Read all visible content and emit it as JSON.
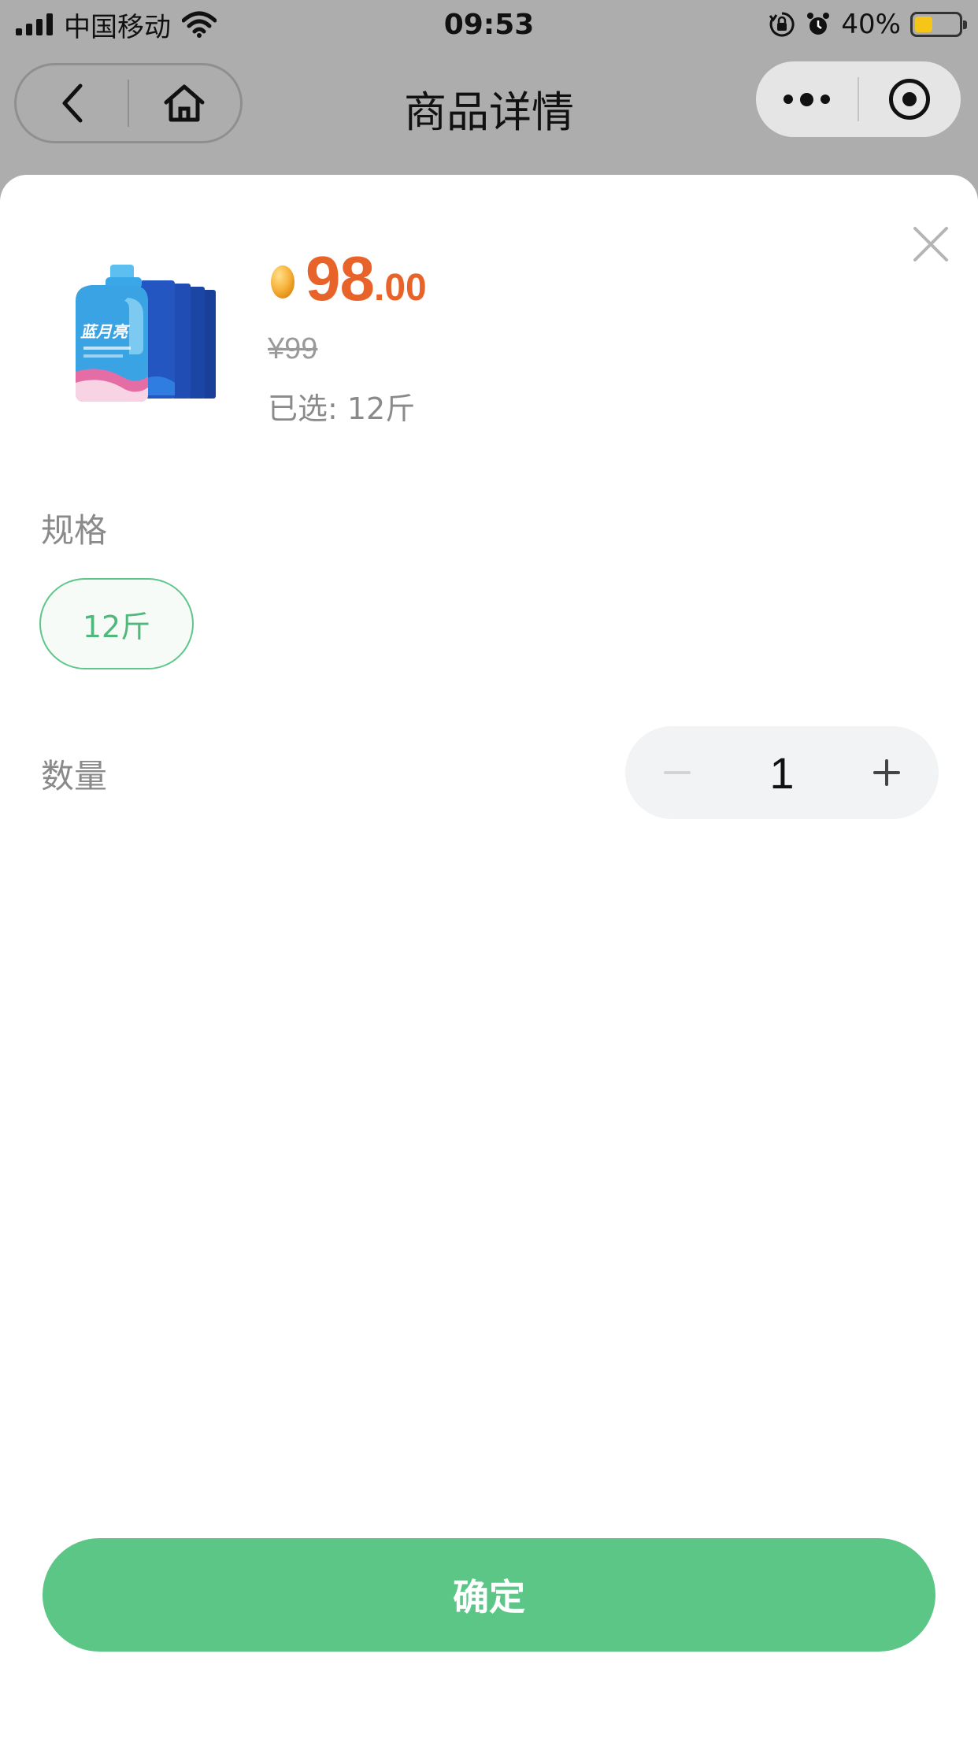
{
  "status_bar": {
    "carrier": "中国移动",
    "time": "09:53",
    "battery_percent": "40%",
    "battery_level": 0.4,
    "icons": [
      "signal-icon",
      "wifi-icon",
      "orientation-lock-icon",
      "alarm-icon",
      "battery-icon"
    ]
  },
  "nav": {
    "title": "商品详情",
    "icons": [
      "back-icon",
      "home-icon",
      "more-icon",
      "capsule-target-icon"
    ]
  },
  "product": {
    "price_integer": "98",
    "price_decimal": ".00",
    "original_price": "¥99",
    "selected_text": "已选: 12斤",
    "image_icon": "laundry-detergent-product-image",
    "price_icon": "coin-icon"
  },
  "spec": {
    "label": "规格",
    "options": [
      "12斤"
    ],
    "selected": "12斤"
  },
  "quantity": {
    "label": "数量",
    "value": "1"
  },
  "confirm_label": "确定",
  "colors": {
    "accent_green": "#5cc687",
    "price_orange": "#e8632a"
  }
}
